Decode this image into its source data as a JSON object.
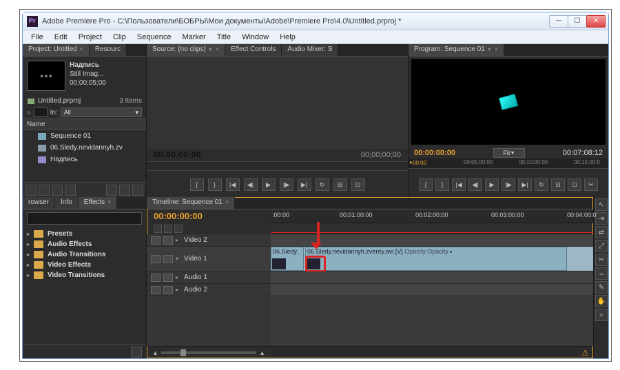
{
  "title": "Adobe Premiere Pro - C:\\Пользователи\\БОБРЫ\\Мои документы\\Adobe\\Premiere Pro\\4.0\\Untitled.prproj *",
  "menu": [
    "File",
    "Edit",
    "Project",
    "Clip",
    "Sequence",
    "Marker",
    "Title",
    "Window",
    "Help"
  ],
  "project": {
    "tab": "Project: Untitled",
    "tab2": "Resourc",
    "asset_name": "Надпись",
    "asset_type": "Still Imag...",
    "asset_dur": "00;00;05;00",
    "file": "Untitled.prproj",
    "count": "3 Items",
    "in_label": "In:",
    "in_value": "All",
    "name_col": "Name",
    "items": [
      "Sequence 01",
      "06.Sledy.nevidannyh.zv",
      "Надпись"
    ]
  },
  "source": {
    "tab": "Source: (no clips)",
    "tab_fx": "Effect Controls",
    "tab_mix": "Audio Mixer: S",
    "tc_left": "00;00;00;00",
    "tc_right": "00;00;00;00"
  },
  "program": {
    "tab": "Program: Sequence 01",
    "tc_left": "00:00:00:00",
    "fit": "Fit",
    "tc_right": "00:07:08:12",
    "ruler": [
      "00:00",
      "00:05:00:00",
      "00:10:00:00",
      "00:15:00:0"
    ]
  },
  "effects": {
    "tab_browser": "rowser",
    "tab_info": "Info",
    "tab_fx": "Effects",
    "folders": [
      "Presets",
      "Audio Effects",
      "Audio Transitions",
      "Video Effects",
      "Video Transitions"
    ]
  },
  "timeline": {
    "tab": "Timeline: Sequence 01",
    "tc": "00:00:00:00",
    "ruler": [
      ":00:00",
      "00:01:00:00",
      "00:02:00:00",
      "00:03:00:00",
      "00:04:00:0"
    ],
    "tracks": {
      "v2": "Video 2",
      "v1": "Video 1",
      "a1": "Audio 1",
      "a2": "Audio 2"
    },
    "clip1": "06.Sledy.",
    "clip2": "06.Sledy.nevidannyh.zverey.avi [V]",
    "clip2_fx": "Opacity:Opacity"
  }
}
